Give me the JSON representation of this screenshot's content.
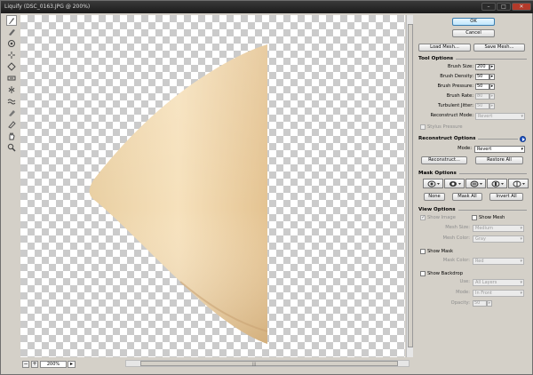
{
  "window": {
    "title": "Liquify (DSC_0163.JPG @ 200%)",
    "buttons": [
      "–",
      "□",
      "✕"
    ]
  },
  "tools": [
    {
      "name": "forward-warp-tool",
      "selected": true
    },
    {
      "name": "reconstruct-tool"
    },
    {
      "name": "twirl-clockwise-tool"
    },
    {
      "name": "pucker-tool"
    },
    {
      "name": "bloat-tool"
    },
    {
      "name": "push-left-tool"
    },
    {
      "name": "mirror-tool"
    },
    {
      "name": "turbulence-tool"
    },
    {
      "name": "freeze-mask-tool"
    },
    {
      "name": "thaw-mask-tool"
    },
    {
      "name": "hand-tool"
    },
    {
      "name": "zoom-tool"
    }
  ],
  "status": {
    "minus": "−",
    "plus": "+",
    "zoom": "200%"
  },
  "top_buttons": {
    "ok": "OK",
    "cancel": "Cancel",
    "load_mesh": "Load Mesh...",
    "save_mesh": "Save Mesh..."
  },
  "tool_options": {
    "title": "Tool Options",
    "brush_size": {
      "label": "Brush Size:",
      "value": "200"
    },
    "brush_density": {
      "label": "Brush Density:",
      "value": "50"
    },
    "brush_pressure": {
      "label": "Brush Pressure:",
      "value": "50"
    },
    "brush_rate": {
      "label": "Brush Rate:",
      "value": "80"
    },
    "turbulent_jitter": {
      "label": "Turbulent Jitter:",
      "value": "50"
    },
    "reconstruct_mode": {
      "label": "Reconstruct Mode:",
      "value": "Revert"
    },
    "stylus_pressure": "Stylus Pressure"
  },
  "reconstruct_options": {
    "title": "Reconstruct Options",
    "mode_label": "Mode:",
    "mode_value": "Revert",
    "reconstruct_btn": "Reconstruct...",
    "restore_btn": "Restore All"
  },
  "mask_options": {
    "title": "Mask Options",
    "none": "None",
    "mask_all": "Mask All",
    "invert_all": "Invert All"
  },
  "view_options": {
    "title": "View Options",
    "show_image": "Show Image",
    "show_mesh": "Show Mesh",
    "mesh_size_label": "Mesh Size:",
    "mesh_size": "Medium",
    "mesh_color_label": "Mesh Color:",
    "mesh_color": "Gray",
    "show_mask": "Show Mask",
    "mask_color_label": "Mask Color:",
    "mask_color": "Red",
    "show_backdrop": "Show Backdrop",
    "use_label": "Use:",
    "use": "All Layers",
    "mode_label": "Mode:",
    "mode": "In Front",
    "opacity_label": "Opacity:",
    "opacity": "50"
  },
  "colors": {
    "skin_light": "#f4dcb2",
    "skin_dark": "#d9b784",
    "accent": "#2457c5"
  }
}
